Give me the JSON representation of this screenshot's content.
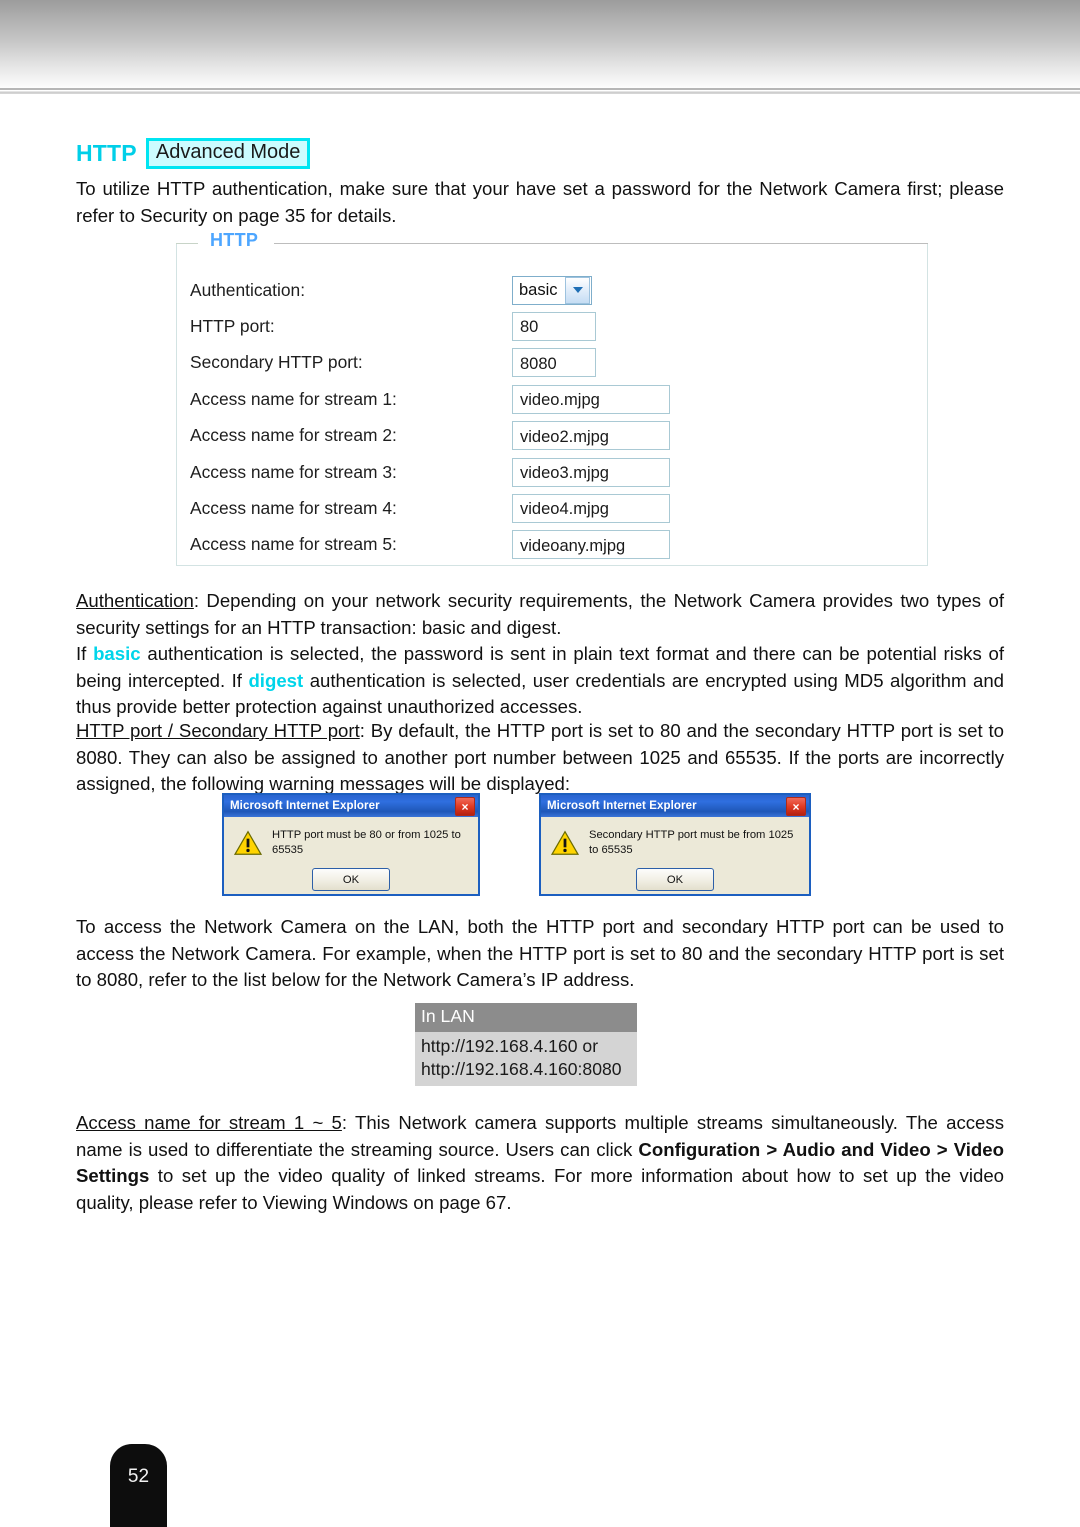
{
  "header": {
    "band": "decorative-gray-gradient"
  },
  "title": {
    "http_label": "HTTP",
    "mode_badge": "Advanced Mode"
  },
  "intro_paragraph": {
    "line": "To utilize HTTP authentication, make sure that your have set a password for the Network Camera first; please refer to Security on page 35 for details."
  },
  "http_panel": {
    "legend": "HTTP",
    "rows": [
      {
        "label": "Authentication:",
        "value": "basic",
        "type": "select"
      },
      {
        "label": "HTTP port:",
        "value": "80",
        "type": "text-small"
      },
      {
        "label": "Secondary HTTP port:",
        "value": "8080",
        "type": "text-small"
      },
      {
        "label": "Access name for stream 1:",
        "value": "video.mjpg",
        "type": "text-medium"
      },
      {
        "label": "Access name for stream 2:",
        "value": "video2.mjpg",
        "type": "text-medium"
      },
      {
        "label": "Access name for stream 3:",
        "value": "video3.mjpg",
        "type": "text-medium"
      },
      {
        "label": "Access name for stream 4:",
        "value": "video4.mjpg",
        "type": "text-medium"
      },
      {
        "label": "Access name for stream 5:",
        "value": "videoany.mjpg",
        "type": "text-medium"
      }
    ]
  },
  "authentication_paragraph": {
    "term": "Authentication",
    "part1": ": Depending on your network security requirements, the Network Camera provides two types of security settings for an HTTP transaction: basic and digest.",
    "part2": "If ",
    "basic": "basic",
    "part3": " authentication is selected, the password is sent in plain text format and there can be potential risks of being intercepted. If ",
    "digest": "digest",
    "part4": " authentication is selected, user credentials are encrypted using MD5 algorithm and thus provide better protection against unauthorized accesses."
  },
  "port_paragraph": {
    "term": "HTTP port / Secondary HTTP port",
    "text": ": By default, the HTTP port is set to 80 and the secondary HTTP port is set to 8080. They can also be assigned to another port number between 1025 and 65535. If the ports are incorrectly assigned, the following warning messages will be displayed:"
  },
  "dialogs": [
    {
      "title": "Microsoft Internet Explorer",
      "message": "HTTP port must be 80 or from 1025 to 65535",
      "ok_label": "OK",
      "close_label": "×",
      "icon": "warning-triangle-icon"
    },
    {
      "title": "Microsoft Internet Explorer",
      "message": "Secondary HTTP port must be from 1025 to 65535",
      "ok_label": "OK",
      "close_label": "×",
      "icon": "warning-triangle-icon"
    }
  ],
  "lan_paragraph": {
    "text": "To access the Network Camera on the LAN, both the HTTP port and secondary HTTP port can be used to access the Network Camera. For example, when the HTTP port is set to 80 and the secondary HTTP port is set to 8080, refer to the list below for the Network Camera’s IP address."
  },
  "lan_table": {
    "header": "In LAN",
    "line1": "http://192.168.4.160  or",
    "line2": "http://192.168.4.160:8080"
  },
  "access_paragraph": {
    "term": "Access name for stream 1 ~ 5",
    "part1": ": This Network camera supports multiple streams simultaneously. The access name is used to differentiate the streaming source. Users can click ",
    "bold1": "Configuration > Audio and Video > Video Settings",
    "part2": " to set up the video quality of linked streams. For more information about how to set up the video quality, please refer to Viewing Windows on page 67."
  },
  "footer": {
    "page_number": "52"
  },
  "colors": {
    "accent_cyan": "#00cfe8",
    "panel_legend_blue": "#4da6ff",
    "dialog_titlebar_blue": "#2a64cf",
    "lan_header_gray": "#8c8c8c",
    "lan_body_gray": "#d4d4d4"
  }
}
